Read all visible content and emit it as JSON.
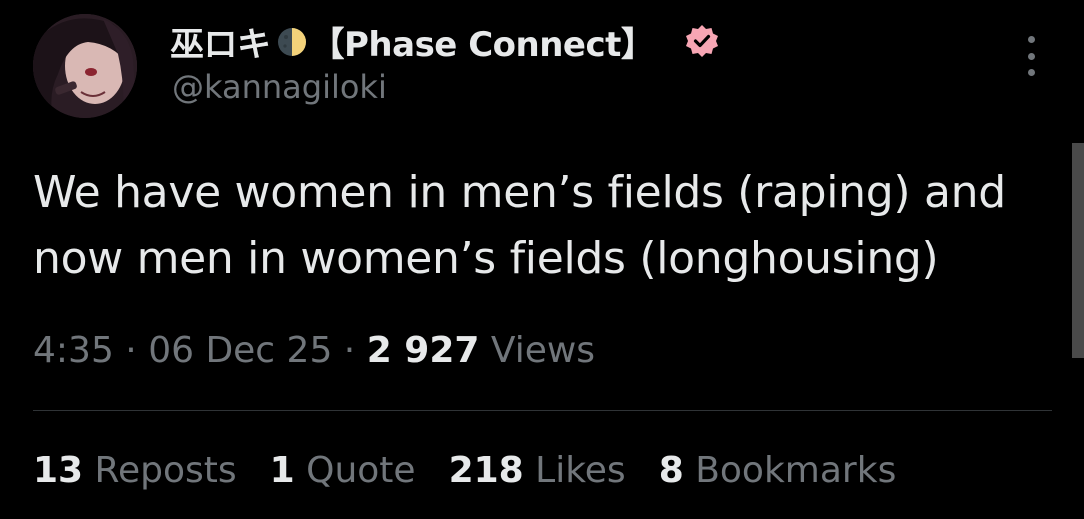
{
  "author": {
    "display_name": "巫ロキ",
    "affiliation": "【Phase Connect】",
    "handle": "@kannagiloki",
    "moon_icon": "half-moon-icon",
    "verified_icon": "verified-badge-icon",
    "verified_color": "#f7a6b4"
  },
  "tweet": {
    "lines": [
      "We have women in men’s fields (raping) and",
      "now men in women’s fields (longhousing)"
    ]
  },
  "meta": {
    "time": "4:35",
    "sep1": " · ",
    "date": "06 Dec 25",
    "sep2": " · ",
    "views_count": "2 927",
    "views_label": " Views"
  },
  "stats": {
    "reposts_count": "13",
    "reposts_label": " Reposts",
    "quotes_count": "1",
    "quotes_label": " Quote",
    "likes_count": "218",
    "likes_label": " Likes",
    "bookmarks_count": "8",
    "bookmarks_label": " Bookmarks"
  },
  "colors": {
    "background": "#000000",
    "primary_text": "#e7e9ea",
    "secondary_text": "#71767b",
    "divider": "#2f3336"
  }
}
